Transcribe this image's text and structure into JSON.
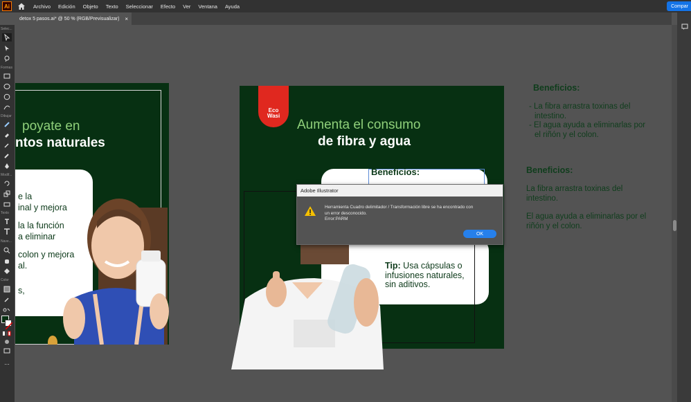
{
  "menubar": {
    "app_logo": "Ai",
    "items": [
      "Archivo",
      "Edición",
      "Objeto",
      "Texto",
      "Seleccionar",
      "Efecto",
      "Ver",
      "Ventana",
      "Ayuda"
    ],
    "share_label": "Compar"
  },
  "doc_tab": {
    "title": "detox 5 pasos.ai* @ 50 % (RGB/Previsualizar)",
    "close": "×"
  },
  "toolbar": {
    "labels": [
      "Selec...",
      "Formas",
      "Dibujar",
      "Modif...",
      "Texto",
      "Nave...",
      "Color"
    ],
    "more": "..."
  },
  "artboard1": {
    "head_light": "poyate en",
    "head_bold": "ntos naturales",
    "card_lines": [
      "e la",
      "inal y mejora",
      "",
      "la la función",
      "a eliminar",
      "",
      "colon y mejora",
      "al.",
      "",
      "",
      "s,"
    ]
  },
  "artboard2": {
    "logo_line1": "Eco",
    "logo_line2": "Wasi",
    "head_light": "Aumenta el consumo",
    "head_bold": "de fibra y agua",
    "card1_title": "Beneficios:",
    "tip_bold": "Tip:",
    "tip_lines": [
      " Usa cápsulas o",
      "infusiones naturales,",
      "sin aditivos."
    ]
  },
  "side_notes": {
    "block1_title": "Beneficios:",
    "block1_lines": [
      "- La fibra arrastra toxinas del",
      "  intestino.",
      "- El agua ayuda a eliminarlas por",
      "  el riñón y el colon."
    ],
    "block2_title": "Beneficios:",
    "block2_lines": [
      " La fibra arrastra toxinas del",
      "intestino.",
      "",
      "El agua ayuda a eliminarlas por el",
      "riñón y el colon."
    ]
  },
  "dialog": {
    "title": "Adobe Illustrator",
    "message_lines": [
      "Herramienta Cuadro delimitador / Transformación libre se ha encontrado con",
      "un error desconocido.",
      "Error:PARM"
    ],
    "ok_label": "OK"
  },
  "colors": {
    "artboard_bg": "#073012",
    "accent_red": "#e0281f",
    "headline_green": "#8fd07a",
    "dialog_button": "#2680eb"
  }
}
